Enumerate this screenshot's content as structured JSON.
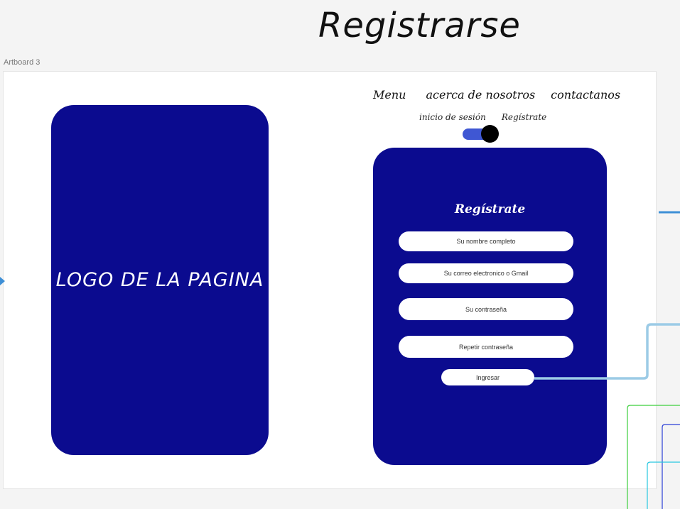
{
  "page_heading": "Registrarse",
  "artboard_label": "Artboard 3",
  "logo_text": "LOGO DE LA PAGINA",
  "nav": {
    "menu": "Menu",
    "about": "acerca de nosotros",
    "contact": "contactanos"
  },
  "switch": {
    "login_label": "inicio de sesión",
    "register_label": "Regístrate",
    "state": "register"
  },
  "form": {
    "title": "Regístrate",
    "name_placeholder": "Su nombre completo",
    "email_placeholder": "Su correo electronico o Gmail",
    "password_placeholder": "Su contraseña",
    "repeat_password_placeholder": "Repetir contraseña",
    "submit_label": "Ingresar"
  },
  "colors": {
    "panel": "#0b0b8f",
    "toggle_track": "#3f57d3",
    "prototype_wire": "#9ccbe6",
    "prototype_arrow": "#3e8fd6"
  }
}
